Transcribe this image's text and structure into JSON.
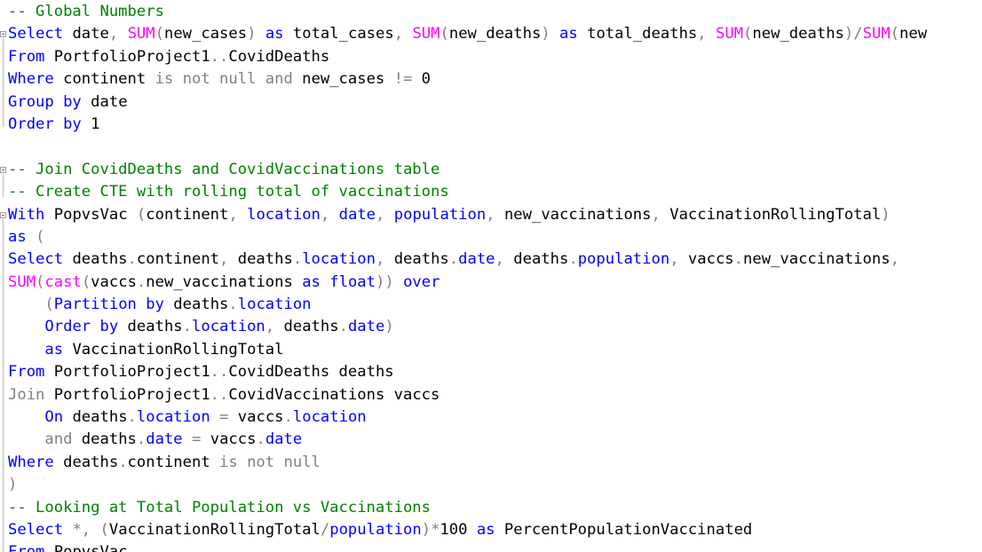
{
  "editor": {
    "colors": {
      "keyword": "#0000ff",
      "function": "#ff00ff",
      "comment": "#008000",
      "operator": "#808080",
      "identifier": "#000000",
      "background": "#ffffff"
    },
    "lines": [
      [
        {
          "t": "-- Global Numbers",
          "c": "cm"
        }
      ],
      [
        {
          "t": "Select",
          "c": "kw"
        },
        {
          "t": " date"
        },
        {
          "t": ",",
          "c": "op"
        },
        {
          "t": " "
        },
        {
          "t": "SUM",
          "c": "fn"
        },
        {
          "t": "(",
          "c": "op"
        },
        {
          "t": "new_cases"
        },
        {
          "t": ")",
          "c": "op"
        },
        {
          "t": " "
        },
        {
          "t": "as",
          "c": "kw"
        },
        {
          "t": " total_cases"
        },
        {
          "t": ",",
          "c": "op"
        },
        {
          "t": " "
        },
        {
          "t": "SUM",
          "c": "fn"
        },
        {
          "t": "(",
          "c": "op"
        },
        {
          "t": "new_deaths"
        },
        {
          "t": ")",
          "c": "op"
        },
        {
          "t": " "
        },
        {
          "t": "as",
          "c": "kw"
        },
        {
          "t": " total_deaths"
        },
        {
          "t": ",",
          "c": "op"
        },
        {
          "t": " "
        },
        {
          "t": "SUM",
          "c": "fn"
        },
        {
          "t": "(",
          "c": "op"
        },
        {
          "t": "new_deaths"
        },
        {
          "t": ")/",
          "c": "op"
        },
        {
          "t": "SUM",
          "c": "fn"
        },
        {
          "t": "(",
          "c": "op"
        },
        {
          "t": "new"
        }
      ],
      [
        {
          "t": "From",
          "c": "kw"
        },
        {
          "t": " PortfolioProject1"
        },
        {
          "t": "..",
          "c": "op"
        },
        {
          "t": "CovidDeaths"
        }
      ],
      [
        {
          "t": "Where",
          "c": "kw"
        },
        {
          "t": " continent "
        },
        {
          "t": "is not null and",
          "c": "op"
        },
        {
          "t": " new_cases "
        },
        {
          "t": "!=",
          "c": "op"
        },
        {
          "t": " 0"
        }
      ],
      [
        {
          "t": "Group by",
          "c": "kw"
        },
        {
          "t": " date"
        }
      ],
      [
        {
          "t": "Order by",
          "c": "kw"
        },
        {
          "t": " 1"
        }
      ],
      [
        {
          "t": ""
        }
      ],
      [
        {
          "t": "-- Join CovidDeaths and CovidVaccinations table",
          "c": "cm"
        }
      ],
      [
        {
          "t": "-- Create CTE with rolling total of vaccinations",
          "c": "cm"
        }
      ],
      [
        {
          "t": "With",
          "c": "kw"
        },
        {
          "t": " PopvsVac "
        },
        {
          "t": "(",
          "c": "op"
        },
        {
          "t": "continent"
        },
        {
          "t": ",",
          "c": "op"
        },
        {
          "t": " "
        },
        {
          "t": "location",
          "c": "kw"
        },
        {
          "t": ",",
          "c": "op"
        },
        {
          "t": " "
        },
        {
          "t": "date",
          "c": "kw"
        },
        {
          "t": ",",
          "c": "op"
        },
        {
          "t": " "
        },
        {
          "t": "population",
          "c": "kw"
        },
        {
          "t": ",",
          "c": "op"
        },
        {
          "t": " new_vaccinations"
        },
        {
          "t": ",",
          "c": "op"
        },
        {
          "t": " VaccinationRollingTotal"
        },
        {
          "t": ")",
          "c": "op"
        }
      ],
      [
        {
          "t": "as",
          "c": "kw"
        },
        {
          "t": " "
        },
        {
          "t": "(",
          "c": "op"
        }
      ],
      [
        {
          "t": "Select",
          "c": "kw"
        },
        {
          "t": " deaths"
        },
        {
          "t": ".",
          "c": "op"
        },
        {
          "t": "continent"
        },
        {
          "t": ",",
          "c": "op"
        },
        {
          "t": " deaths"
        },
        {
          "t": ".",
          "c": "op"
        },
        {
          "t": "location",
          "c": "kw"
        },
        {
          "t": ",",
          "c": "op"
        },
        {
          "t": " deaths"
        },
        {
          "t": ".",
          "c": "op"
        },
        {
          "t": "date",
          "c": "kw"
        },
        {
          "t": ",",
          "c": "op"
        },
        {
          "t": " deaths"
        },
        {
          "t": ".",
          "c": "op"
        },
        {
          "t": "population",
          "c": "kw"
        },
        {
          "t": ",",
          "c": "op"
        },
        {
          "t": " vaccs"
        },
        {
          "t": ".",
          "c": "op"
        },
        {
          "t": "new_vaccinations"
        },
        {
          "t": ",",
          "c": "op"
        }
      ],
      [
        {
          "t": "SUM",
          "c": "fn"
        },
        {
          "t": "(",
          "c": "op"
        },
        {
          "t": "cast",
          "c": "fn"
        },
        {
          "t": "(",
          "c": "op"
        },
        {
          "t": "vaccs"
        },
        {
          "t": ".",
          "c": "op"
        },
        {
          "t": "new_vaccinations "
        },
        {
          "t": "as",
          "c": "kw"
        },
        {
          "t": " "
        },
        {
          "t": "float",
          "c": "kw"
        },
        {
          "t": "))",
          "c": "op"
        },
        {
          "t": " "
        },
        {
          "t": "over",
          "c": "kw"
        }
      ],
      [
        {
          "t": "    "
        },
        {
          "t": "(",
          "c": "op"
        },
        {
          "t": "Partition by",
          "c": "kw"
        },
        {
          "t": " deaths"
        },
        {
          "t": ".",
          "c": "op"
        },
        {
          "t": "location",
          "c": "kw"
        }
      ],
      [
        {
          "t": "    "
        },
        {
          "t": "Order by",
          "c": "kw"
        },
        {
          "t": " deaths"
        },
        {
          "t": ".",
          "c": "op"
        },
        {
          "t": "location",
          "c": "kw"
        },
        {
          "t": ",",
          "c": "op"
        },
        {
          "t": " deaths"
        },
        {
          "t": ".",
          "c": "op"
        },
        {
          "t": "date",
          "c": "kw"
        },
        {
          "t": ")",
          "c": "op"
        }
      ],
      [
        {
          "t": "    "
        },
        {
          "t": "as",
          "c": "kw"
        },
        {
          "t": " VaccinationRollingTotal"
        }
      ],
      [
        {
          "t": "From",
          "c": "kw"
        },
        {
          "t": " PortfolioProject1"
        },
        {
          "t": "..",
          "c": "op"
        },
        {
          "t": "CovidDeaths deaths"
        }
      ],
      [
        {
          "t": "Join",
          "c": "op"
        },
        {
          "t": " PortfolioProject1"
        },
        {
          "t": "..",
          "c": "op"
        },
        {
          "t": "CovidVaccinations vaccs"
        }
      ],
      [
        {
          "t": "    "
        },
        {
          "t": "On",
          "c": "kw"
        },
        {
          "t": " deaths"
        },
        {
          "t": ".",
          "c": "op"
        },
        {
          "t": "location",
          "c": "kw"
        },
        {
          "t": " "
        },
        {
          "t": "=",
          "c": "op"
        },
        {
          "t": " vaccs"
        },
        {
          "t": ".",
          "c": "op"
        },
        {
          "t": "location",
          "c": "kw"
        }
      ],
      [
        {
          "t": "    "
        },
        {
          "t": "and",
          "c": "op"
        },
        {
          "t": " deaths"
        },
        {
          "t": ".",
          "c": "op"
        },
        {
          "t": "date",
          "c": "kw"
        },
        {
          "t": " "
        },
        {
          "t": "=",
          "c": "op"
        },
        {
          "t": " vaccs"
        },
        {
          "t": ".",
          "c": "op"
        },
        {
          "t": "date",
          "c": "kw"
        }
      ],
      [
        {
          "t": "Where",
          "c": "kw"
        },
        {
          "t": " deaths"
        },
        {
          "t": ".",
          "c": "op"
        },
        {
          "t": "continent "
        },
        {
          "t": "is not null",
          "c": "op"
        }
      ],
      [
        {
          "t": ")",
          "c": "op"
        }
      ],
      [
        {
          "t": "-- Looking at Total Population vs Vaccinations",
          "c": "cm"
        }
      ],
      [
        {
          "t": "Select",
          "c": "kw"
        },
        {
          "t": " "
        },
        {
          "t": "*,",
          "c": "op"
        },
        {
          "t": " "
        },
        {
          "t": "(",
          "c": "op"
        },
        {
          "t": "VaccinationRollingTotal"
        },
        {
          "t": "/",
          "c": "op"
        },
        {
          "t": "population",
          "c": "kw"
        },
        {
          "t": ")*",
          "c": "op"
        },
        {
          "t": "100 "
        },
        {
          "t": "as",
          "c": "kw"
        },
        {
          "t": " PercentPopulationVaccinated"
        }
      ],
      [
        {
          "t": "From",
          "c": "kw"
        },
        {
          "t": " PopvsVac"
        }
      ]
    ]
  }
}
